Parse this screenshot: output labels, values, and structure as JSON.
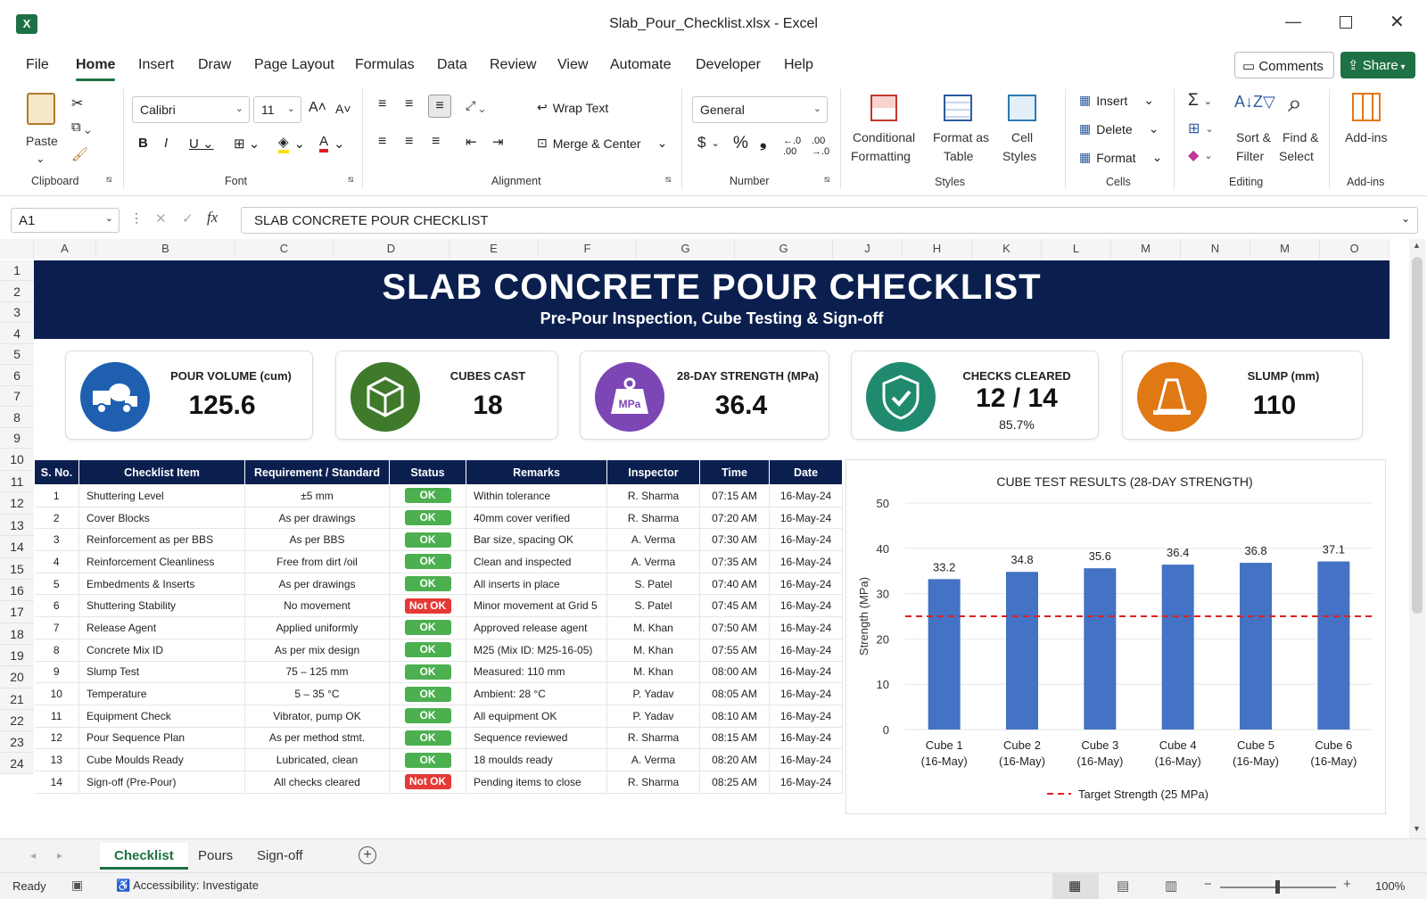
{
  "window": {
    "title": "Slab_Pour_Checklist.xlsx  -  Excel",
    "app_icon": "excel-icon"
  },
  "menu": {
    "items": [
      "File",
      "Home",
      "Insert",
      "Draw",
      "Page Layout",
      "Formulas",
      "Data",
      "Review",
      "View",
      "Automate",
      "Developer",
      "Help"
    ],
    "active": "Home",
    "comments": "Comments",
    "share": "Share"
  },
  "ribbon": {
    "clipboard": {
      "paste": "Paste",
      "group": "Clipboard"
    },
    "font": {
      "name": "Calibri",
      "size": "11",
      "group": "Font"
    },
    "alignment": {
      "wrap": "Wrap Text",
      "merge": "Merge & Center",
      "group": "Alignment"
    },
    "number": {
      "format": "General",
      "group": "Number"
    },
    "styles": {
      "cond1": "Conditional",
      "cond2": "Formatting",
      "fat1": "Format as",
      "fat2": "Table",
      "cs1": "Cell",
      "cs2": "Styles",
      "group": "Styles"
    },
    "cells": {
      "insert": "Insert",
      "delete": "Delete",
      "format": "Format",
      "group": "Cells"
    },
    "editing": {
      "sort1": "Sort &",
      "sort2": "Filter",
      "find1": "Find &",
      "find2": "Select",
      "group": "Editing"
    },
    "addins": {
      "label": "Add-ins",
      "group": "Add-ins"
    }
  },
  "formula_bar": {
    "name_box": "A1",
    "content": "SLAB CONCRETE POUR CHECKLIST",
    "fx": "fx"
  },
  "columns": [
    "A",
    "B",
    "C",
    "D",
    "E",
    "F",
    "G",
    "G",
    "J",
    "H",
    "K",
    "L",
    "M",
    "N",
    "M",
    "O"
  ],
  "rows": [
    "1",
    "2",
    "3",
    "4",
    "5",
    "6",
    "7",
    "8",
    "9",
    "10",
    "11",
    "12",
    "13",
    "14",
    "15",
    "16",
    "17",
    "18",
    "19",
    "20",
    "21",
    "22",
    "23",
    "24"
  ],
  "banner": {
    "title": "SLAB CONCRETE POUR CHECKLIST",
    "subtitle": "Pre-Pour Inspection, Cube Testing & Sign-off"
  },
  "kpis": [
    {
      "title": "POUR VOLUME (cum)",
      "value": "125.6",
      "sub": "",
      "icon": "concrete-mixer-icon",
      "color": "#1f5fb0"
    },
    {
      "title": "CUBES CAST",
      "value": "18",
      "sub": "",
      "icon": "cube-icon",
      "color": "#3e7a2a"
    },
    {
      "title": "28-DAY STRENGTH (MPa)",
      "value": "36.4",
      "sub": "",
      "icon": "weight-mpa-icon",
      "color": "#7d46b5",
      "badge": "MPa"
    },
    {
      "title": "CHECKS CLEARED",
      "value": "12 / 14",
      "sub": "85.7%",
      "icon": "shield-check-icon",
      "color": "#1f8a6e"
    },
    {
      "title": "SLUMP (mm)",
      "value": "110",
      "sub": "",
      "icon": "slump-cone-icon",
      "color": "#e07814"
    }
  ],
  "table": {
    "headers": [
      "S. No.",
      "Checklist Item",
      "Requirement / Standard",
      "Status",
      "Remarks",
      "Inspector",
      "Time",
      "Date"
    ],
    "rows": [
      [
        "1",
        "Shuttering Level",
        "±5 mm",
        "OK",
        "Within tolerance",
        "R. Sharma",
        "07:15 AM",
        "16-May-24"
      ],
      [
        "2",
        "Cover Blocks",
        "As per drawings",
        "OK",
        "40mm cover verified",
        "R. Sharma",
        "07:20 AM",
        "16-May-24"
      ],
      [
        "3",
        "Reinforcement as per BBS",
        "As per BBS",
        "OK",
        "Bar size, spacing OK",
        "A. Verma",
        "07:30 AM",
        "16-May-24"
      ],
      [
        "4",
        "Reinforcement Cleanliness",
        "Free from dirt /oil",
        "OK",
        "Clean and inspected",
        "A. Verma",
        "07:35 AM",
        "16-May-24"
      ],
      [
        "5",
        "Embedments & Inserts",
        "As per drawings",
        "OK",
        "All inserts in place",
        "S. Patel",
        "07:40 AM",
        "16-May-24"
      ],
      [
        "6",
        "Shuttering Stability",
        "No movement",
        "Not OK",
        "Minor movement at Grid 5",
        "S. Patel",
        "07:45 AM",
        "16-May-24"
      ],
      [
        "7",
        "Release Agent",
        "Applied uniformly",
        "OK",
        "Approved release agent",
        "M. Khan",
        "07:50 AM",
        "16-May-24"
      ],
      [
        "8",
        "Concrete Mix ID",
        "As per mix design",
        "OK",
        "M25 (Mix ID: M25-16-05)",
        "M. Khan",
        "07:55 AM",
        "16-May-24"
      ],
      [
        "9",
        "Slump Test",
        "75 – 125 mm",
        "OK",
        "Measured: 110 mm",
        "M. Khan",
        "08:00 AM",
        "16-May-24"
      ],
      [
        "10",
        "Temperature",
        "5 – 35 °C",
        "OK",
        "Ambient: 28 °C",
        "P. Yadav",
        "08:05 AM",
        "16-May-24"
      ],
      [
        "11",
        "Equipment Check",
        "Vibrator, pump OK",
        "OK",
        "All equipment OK",
        "P. Yadav",
        "08:10 AM",
        "16-May-24"
      ],
      [
        "12",
        "Pour Sequence Plan",
        "As per method stmt.",
        "OK",
        "Sequence reviewed",
        "R. Sharma",
        "08:15 AM",
        "16-May-24"
      ],
      [
        "13",
        "Cube Moulds Ready",
        "Lubricated, clean",
        "OK",
        "18 moulds ready",
        "A. Verma",
        "08:20 AM",
        "16-May-24"
      ],
      [
        "14",
        "Sign-off (Pre-Pour)",
        "All checks cleared",
        "Not OK",
        "Pending items to close",
        "R. Sharma",
        "08:25 AM",
        "16-May-24"
      ]
    ]
  },
  "chart_data": {
    "type": "bar",
    "title": "CUBE TEST RESULTS (28-DAY STRENGTH)",
    "categories": [
      "Cube 1",
      "Cube 2",
      "Cube 3",
      "Cube 4",
      "Cube 5",
      "Cube 6"
    ],
    "category_sub": [
      "(16-May)",
      "(16-May)",
      "(16-May)",
      "(16-May)",
      "(16-May)",
      "(16-May)"
    ],
    "values": [
      33.2,
      34.8,
      35.6,
      36.4,
      36.8,
      37.1
    ],
    "ylabel": "Strength (MPa)",
    "xlabel": "",
    "ylim": [
      0,
      50
    ],
    "yticks": [
      0,
      10,
      20,
      30,
      40,
      50
    ],
    "target": 25,
    "target_label": "Target Strength (25 MPa)",
    "bar_color": "#4472c4",
    "target_color": "#e02020",
    "grid": true,
    "legend": "bottom"
  },
  "sheets": {
    "tabs": [
      "Checklist",
      "Pours",
      "Sign-off"
    ],
    "active": "Checklist"
  },
  "status": {
    "ready": "Ready",
    "accessibility": "Accessibility: Investigate",
    "zoom": "100%"
  }
}
